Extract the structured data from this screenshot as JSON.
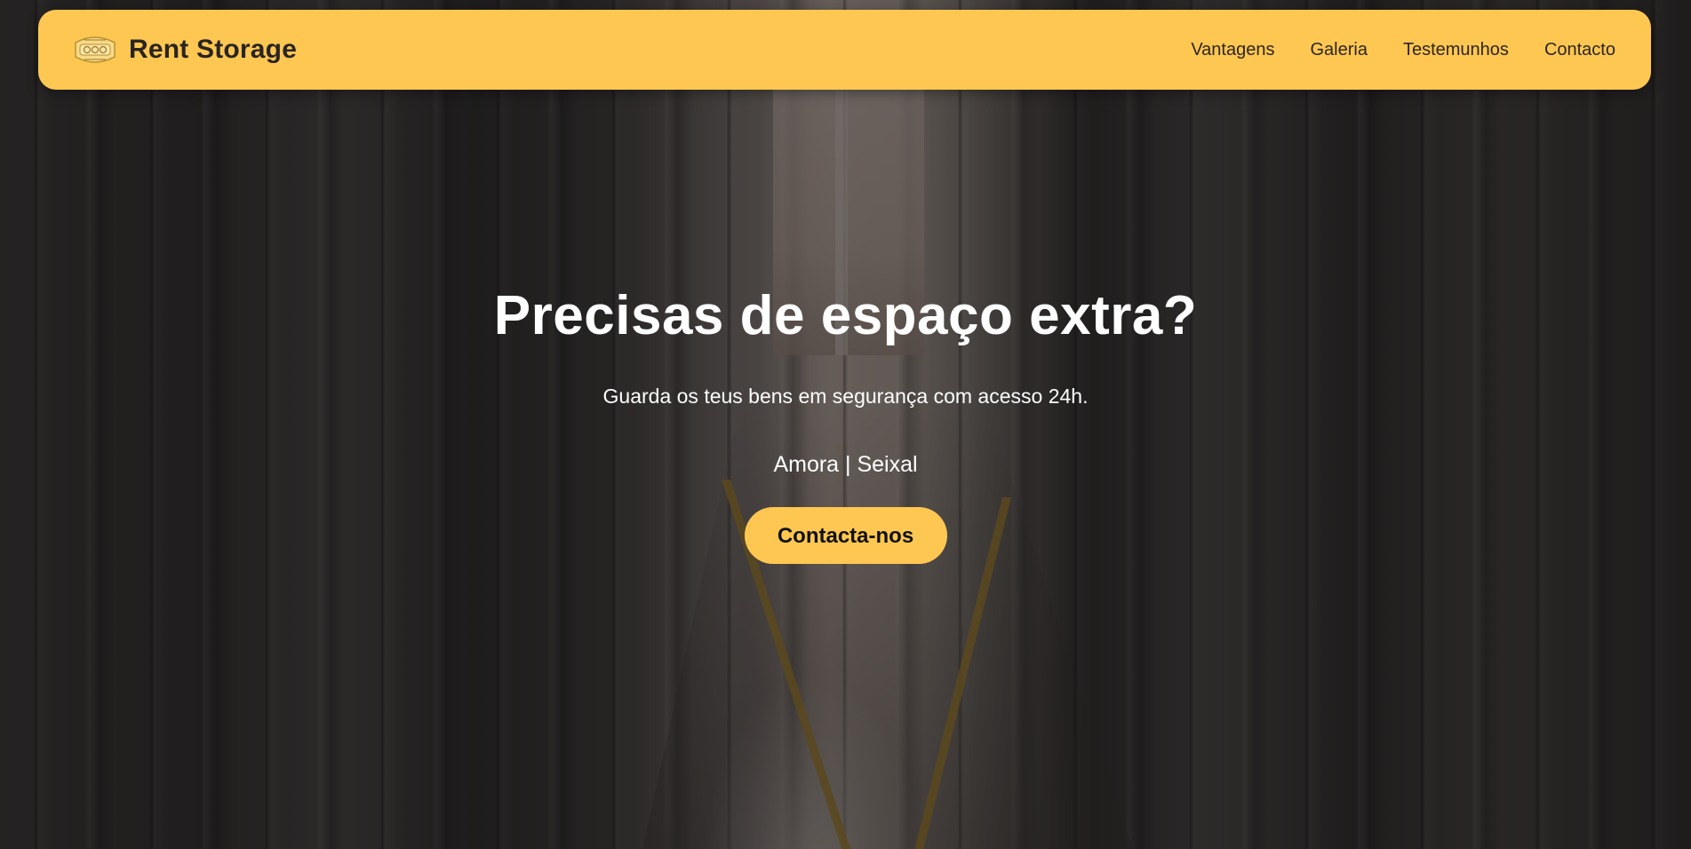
{
  "brand": {
    "name": "Rent Storage",
    "logo_icon": "storage-logo-icon"
  },
  "nav": {
    "items": [
      {
        "label": "Vantagens"
      },
      {
        "label": "Galeria"
      },
      {
        "label": "Testemunhos"
      },
      {
        "label": "Contacto"
      }
    ]
  },
  "hero": {
    "title": "Precisas de espaço extra?",
    "subtitle": "Guarda os teus bens em segurança com acesso 24h.",
    "location": "Amora | Seixal",
    "cta_label": "Contacta-nos"
  },
  "colors": {
    "accent": "#fec751",
    "text_dark": "#2a2422",
    "text_light": "#ffffff"
  }
}
